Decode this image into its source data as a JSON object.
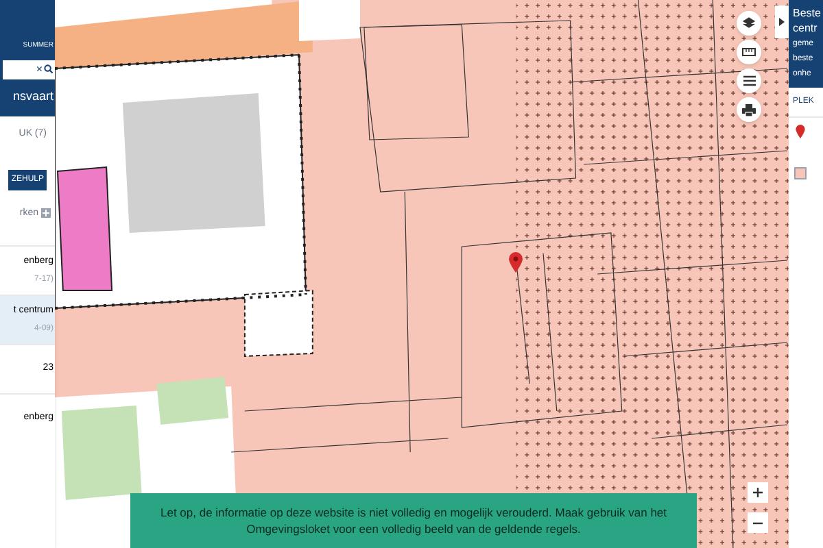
{
  "left_panel": {
    "header_label": "SUMMER",
    "search_clear": "×",
    "title": "nsvaart",
    "subtitle": "UK (7)",
    "help_button": "ZEHULP",
    "filter_label": "rken",
    "items": [
      {
        "title": "enberg",
        "date": "7-17)",
        "selected": false
      },
      {
        "title": "t centrum",
        "date": "4-09)",
        "selected": true
      },
      {
        "title": "23",
        "selected": false
      },
      {
        "title": "enberg",
        "selected": false
      }
    ]
  },
  "map": {
    "notice": "Let op, de informatie op deze website is niet volledig en mogelijk verouderd. Maak gebruik van het Omgevingsloket voor een volledig beeld van de geldende regels."
  },
  "right_panel": {
    "title_lines": [
      "Beste",
      "centr"
    ],
    "info_lines": [
      "geme",
      "beste",
      "onhe"
    ],
    "tab": "PLEK"
  }
}
